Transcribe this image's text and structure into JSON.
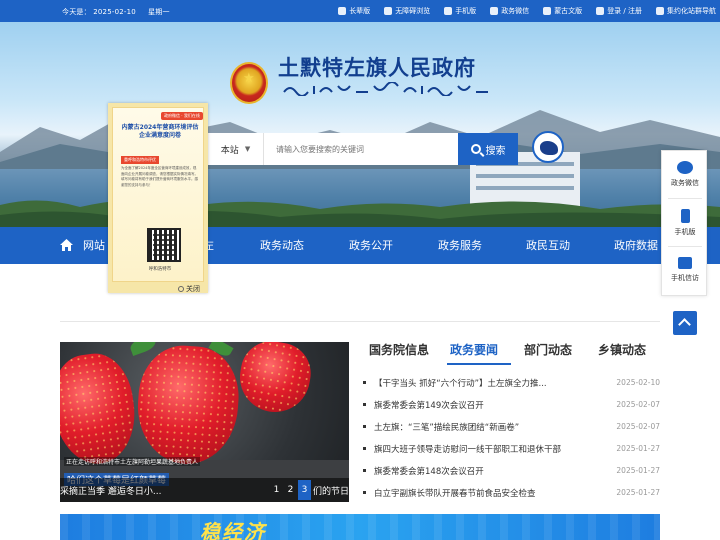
{
  "topbar": {
    "date_label": "今天是：",
    "date": "2025-02-10",
    "weekday": "星期一",
    "links": [
      "长辈版",
      "无障碍浏览",
      "手机版",
      "政务微信",
      "蒙古文版",
      "登录 / 注册",
      "集约化站群导航"
    ]
  },
  "header": {
    "site_title": "土默特左旗人民政府"
  },
  "search": {
    "scope": "本站",
    "placeholder": "请输入您要搜索的关键词",
    "button": "搜索"
  },
  "nav": {
    "items": [
      "网站首页",
      "走进土左",
      "政务动态",
      "政务公开",
      "政务服务",
      "政民互动",
      "政府数据"
    ],
    "visible_partials": [
      "网站",
      "左"
    ]
  },
  "popup": {
    "ribbon": "政府微信 · 我们在线",
    "title": "内蒙古2024年营商环境评估企业满意度问卷",
    "tag": "重呼和浩特市评优",
    "body": "为全面了解2024年度全区营商环境建设成效，现面向企业开展问卷调查，请您根据实际情况填写。填写问卷将有助于我们提升营商环境服务水平。感谢您的支持与参与！",
    "qr_caption": "呼和浩特市",
    "close": "关闭"
  },
  "float_panel": {
    "items": [
      "政务微信",
      "手机版",
      "手机信访"
    ]
  },
  "carousel": {
    "subtitle": "正在走访呼和浩特市土左旗阿勒坦果蔬基地负责人",
    "blue_caption": "哈们这个草莓是红颜草莓",
    "caption": "采摘正当季 邂逅冬日小...",
    "dots": [
      "1",
      "2",
      "3"
    ],
    "active_dot": 2,
    "dot_tail": "们的节日"
  },
  "tabs": {
    "items": [
      "国务院信息",
      "政务要闻",
      "部门动态",
      "乡镇动态"
    ],
    "active": 1
  },
  "news": [
    {
      "title": "【干字当头 抓好“六个行动”】土左旗全力推...",
      "date": "2025-02-10"
    },
    {
      "title": "旗委常委会第149次会议召开",
      "date": "2025-02-07"
    },
    {
      "title": "土左旗：“三笔”描绘民族团结“新画卷”",
      "date": "2025-02-07"
    },
    {
      "title": "旗四大班子领导走访慰问一线干部职工和退休干部",
      "date": "2025-01-27"
    },
    {
      "title": "旗委常委会第148次会议召开",
      "date": "2025-01-27"
    },
    {
      "title": "白立宇副旗长带队开展春节前食品安全检查",
      "date": "2025-01-27"
    }
  ],
  "promo": {
    "text": "稳经济"
  },
  "colors": {
    "primary": "#1e63c5",
    "title": "#123f8f",
    "emblem_red": "#c8281e",
    "emblem_gold": "#e9b52c"
  }
}
